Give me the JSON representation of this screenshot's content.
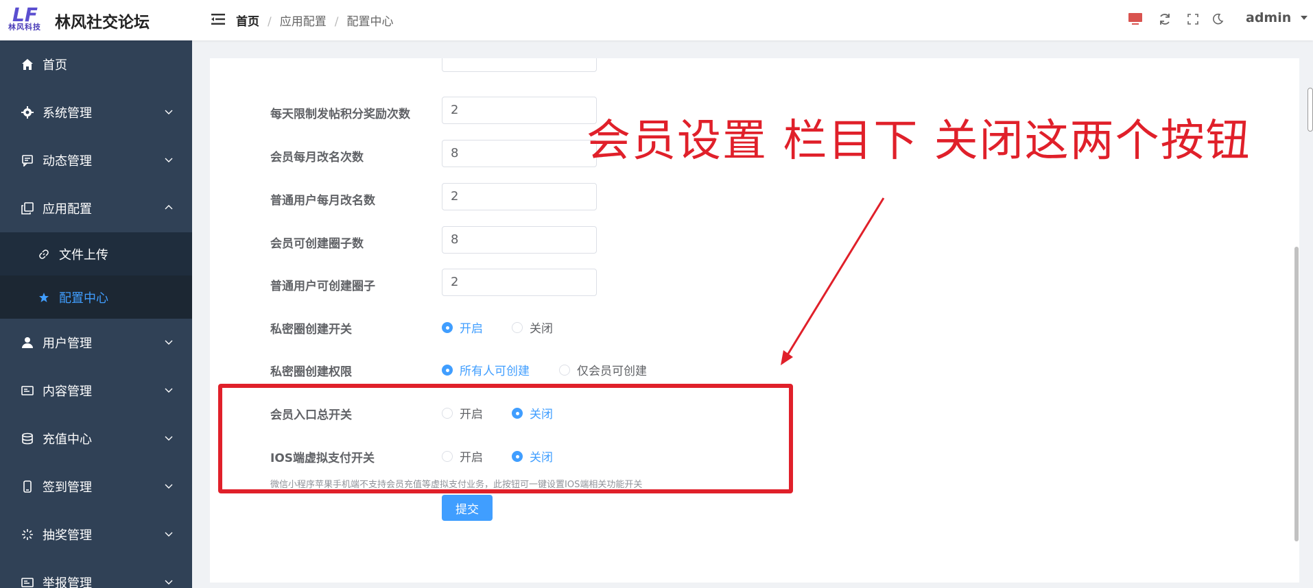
{
  "header": {
    "logo_sub": "林风科技",
    "site_title": "林风社交论坛",
    "breadcrumb": [
      "首页",
      "应用配置",
      "配置中心"
    ],
    "user": "admin"
  },
  "sidebar": {
    "items": [
      {
        "label": "首页",
        "icon": "home-icon"
      },
      {
        "label": "系统管理",
        "icon": "gear-icon"
      },
      {
        "label": "动态管理",
        "icon": "message-icon"
      },
      {
        "label": "应用配置",
        "icon": "copy-icon",
        "expanded": true
      },
      {
        "label": "文件上传",
        "icon": "link-icon"
      },
      {
        "label": "配置中心",
        "icon": "star-icon",
        "active": true
      },
      {
        "label": "用户管理",
        "icon": "user-icon"
      },
      {
        "label": "内容管理",
        "icon": "content-icon"
      },
      {
        "label": "充值中心",
        "icon": "database-icon"
      },
      {
        "label": "签到管理",
        "icon": "phone-icon"
      },
      {
        "label": "抽奖管理",
        "icon": "loading-icon"
      },
      {
        "label": "举报管理",
        "icon": "report-icon"
      }
    ]
  },
  "form": {
    "rows": [
      {
        "label": "每天限制发帖积分奖励次数",
        "value": "2"
      },
      {
        "label": "会员每月改名次数",
        "value": "8"
      },
      {
        "label": "普通用户每月改名数",
        "value": "2"
      },
      {
        "label": "会员可创建圈子数",
        "value": "8"
      },
      {
        "label": "普通用户可创建圈子",
        "value": "2"
      }
    ],
    "radios": [
      {
        "label": "私密圈创建开关",
        "options": [
          "开启",
          "关闭"
        ],
        "selected": 0
      },
      {
        "label": "私密圈创建权限",
        "options": [
          "所有人可创建",
          "仅会员可创建"
        ],
        "selected": 0
      },
      {
        "label": "会员入口总开关",
        "options": [
          "开启",
          "关闭"
        ],
        "selected": 1
      },
      {
        "label": "IOS端虚拟支付开关",
        "options": [
          "开启",
          "关闭"
        ],
        "selected": 1
      }
    ],
    "hint": "微信小程序苹果手机端不支持会员充值等虚拟支付业务，此按钮可一键设置IOS端相关功能开关",
    "submit": "提交"
  },
  "annotation": {
    "text": "会员设置 栏目下 关闭这两个按钮",
    "color": "#e0202a"
  },
  "colors": {
    "accent": "#409eff",
    "sidebar": "#304156"
  }
}
